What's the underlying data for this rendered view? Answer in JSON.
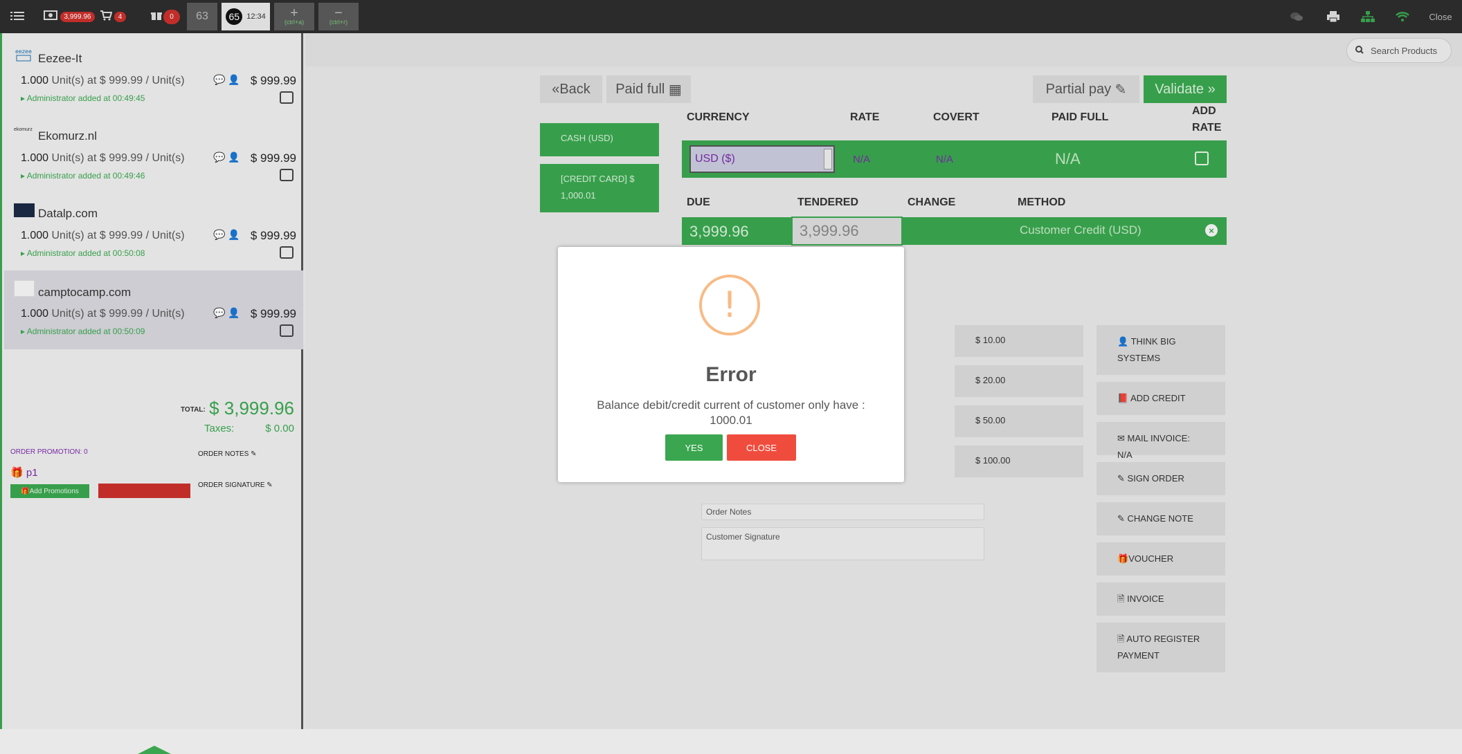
{
  "topbar": {
    "list_icon": "list-icon",
    "cash_badge": "3,999.96",
    "cart_badge": "4",
    "gift_badge": "0",
    "tab_63": "63",
    "tab_65_num": "65",
    "tab_65_time": "12:34",
    "add_tab_hint": "(ctrl+a)",
    "remove_tab_hint": "(ctrl+r)",
    "close_label": "Close",
    "accent": "#3aa64f"
  },
  "orders": [
    {
      "logo": "eezee",
      "name": "Eezee-It",
      "qty": "1.000",
      "unit_text": "Unit(s) at $ 999.99 / Unit(s)",
      "price": "$ 999.99",
      "admin": "Administrator added at 00:49:45"
    },
    {
      "logo": "ekomurz",
      "name": "Ekomurz.nl",
      "qty": "1.000",
      "unit_text": "Unit(s) at $ 999.99 / Unit(s)",
      "price": "$ 999.99",
      "admin": "Administrator added at 00:49:46"
    },
    {
      "logo": "",
      "name": "Datalp.com",
      "qty": "1.000",
      "unit_text": "Unit(s) at $ 999.99 / Unit(s)",
      "price": "$ 999.99",
      "admin": "Administrator added at 00:50:08"
    },
    {
      "logo": "",
      "name": "camptocamp.com",
      "qty": "1.000",
      "unit_text": "Unit(s) at $ 999.99 / Unit(s)",
      "price": "$ 999.99",
      "admin": "Administrator added at 00:50:09"
    }
  ],
  "summary": {
    "total_label": "TOTAL:",
    "total_value": "$ 3,999.96",
    "taxes_label": "Taxes:",
    "taxes_value": "$ 0.00",
    "order_promotion": "ORDER PROMOTION: 0",
    "promo_item": "p1",
    "add_promotions": "Add Promotions",
    "order_notes": "ORDER NOTES",
    "order_signature": "ORDER SIGNATURE"
  },
  "search": {
    "placeholder": "Search Products"
  },
  "payment": {
    "back": "Back",
    "paid_full": "Paid full",
    "partial_pay": "Partial pay",
    "validate": "Validate",
    "methods": [
      "CASH (USD)",
      "[CREDIT CARD] $ 1,000.01"
    ],
    "headers1": {
      "currency": "CURRENCY",
      "rate": "RATE",
      "covert": "COVERT",
      "paid_full": "PAID FULL",
      "add_rate": "ADD RATE"
    },
    "currency_value": "USD ($)",
    "rate_value": "N/A",
    "covert_value": "N/A",
    "paid_full_value": "N/A",
    "headers2": {
      "due": "DUE",
      "tendered": "TENDERED",
      "change": "CHANGE",
      "method": "METHOD"
    },
    "due_value": "3,999.96",
    "tendered_value": "3,999.96",
    "method_value": "Customer Credit (USD)",
    "amounts": [
      "$ 10.00",
      "$ 20.00",
      "$ 50.00",
      "$ 100.00"
    ],
    "actions": [
      "THINK BIG SYSTEMS",
      "ADD CREDIT",
      "MAIL INVOICE: N/A",
      "SIGN ORDER",
      "CHANGE NOTE",
      "VOUCHER",
      "INVOICE",
      "AUTO REGISTER PAYMENT"
    ],
    "order_notes_placeholder": "Order Notes",
    "customer_signature_placeholder": "Customer Signature"
  },
  "dialog": {
    "icon": "!",
    "title": "Error",
    "message": "Balance debit/credit current of customer only have : 1000.01",
    "yes": "YES",
    "close": "CLOSE"
  }
}
